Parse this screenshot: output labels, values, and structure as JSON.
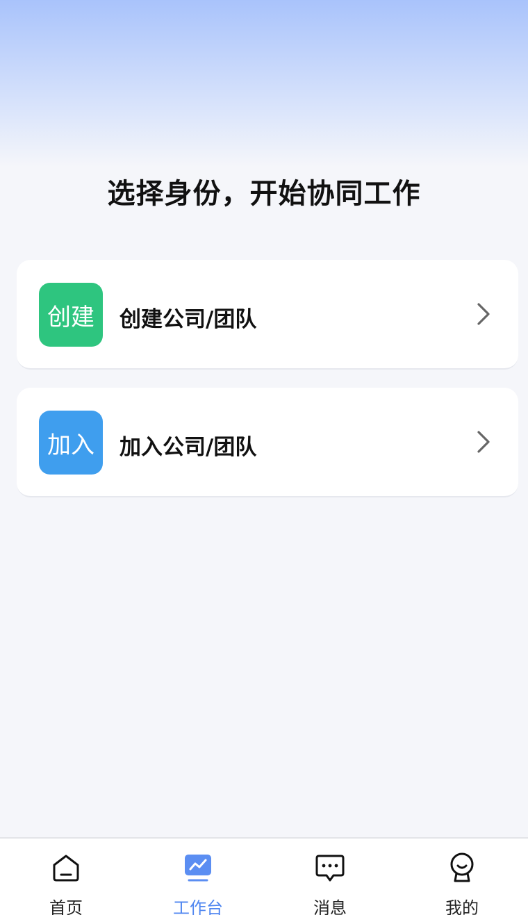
{
  "main": {
    "title": "选择身份，开始协同工作"
  },
  "cards": [
    {
      "badge_text": "创建",
      "label": "创建公司/团队",
      "badge_color": "#2ec57f"
    },
    {
      "badge_text": "加入",
      "label": "加入公司/团队",
      "badge_color": "#3f9eee"
    }
  ],
  "tabbar": {
    "items": [
      {
        "label": "首页",
        "icon": "home-icon"
      },
      {
        "label": "工作台",
        "icon": "workbench-icon",
        "active": true
      },
      {
        "label": "消息",
        "icon": "message-icon"
      },
      {
        "label": "我的",
        "icon": "profile-icon"
      }
    ],
    "active_color": "#4f86f0"
  }
}
